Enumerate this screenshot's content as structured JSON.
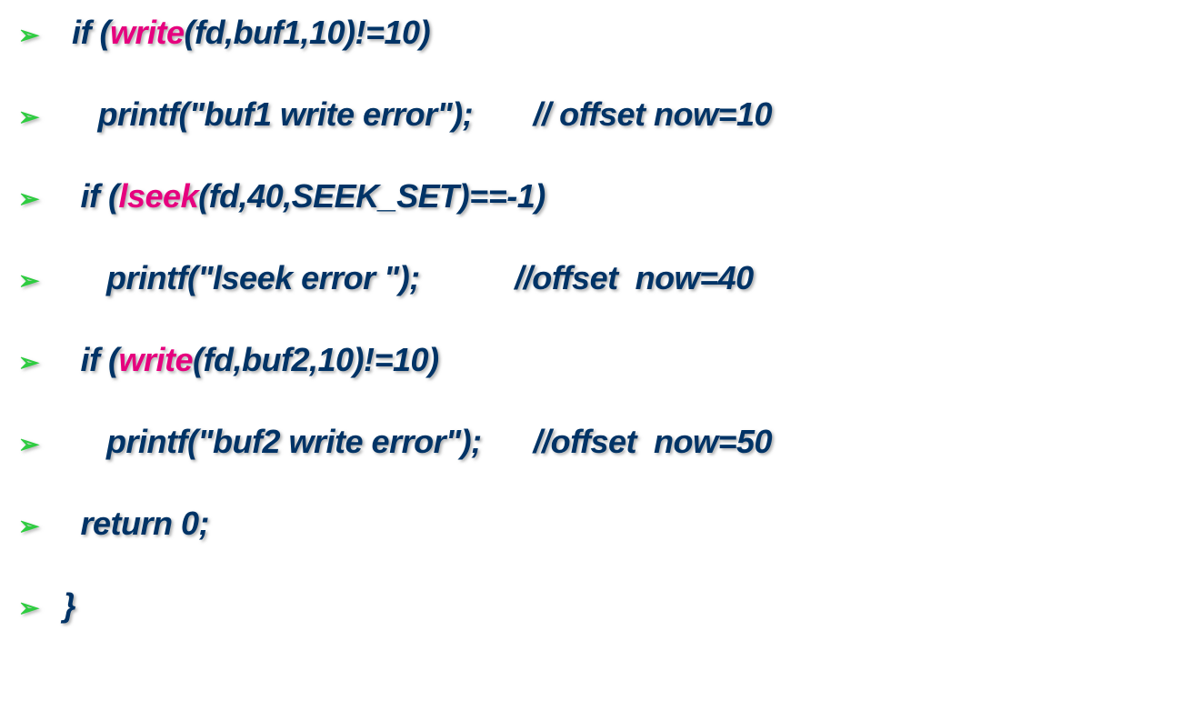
{
  "lines": [
    {
      "segments": [
        {
          "text": "  if (",
          "highlight": false
        },
        {
          "text": "write",
          "highlight": true
        },
        {
          "text": "(fd,buf1,10)!=10)",
          "highlight": false
        }
      ]
    },
    {
      "segments": [
        {
          "text": "     printf(\"buf1 write error\");       // offset now=10",
          "highlight": false
        }
      ]
    },
    {
      "segments": [
        {
          "text": "   if (",
          "highlight": false
        },
        {
          "text": "lseek",
          "highlight": true
        },
        {
          "text": "(fd,40,SEEK_SET)==-1)",
          "highlight": false
        }
      ]
    },
    {
      "segments": [
        {
          "text": "      printf(\"lseek error \");           //offset  now=40",
          "highlight": false
        }
      ]
    },
    {
      "segments": [
        {
          "text": "   if (",
          "highlight": false
        },
        {
          "text": "write",
          "highlight": true
        },
        {
          "text": "(fd,buf2,10)!=10)",
          "highlight": false
        }
      ]
    },
    {
      "segments": [
        {
          "text": "      printf(\"buf2 write error\");      //offset  now=50",
          "highlight": false
        }
      ]
    },
    {
      "segments": [
        {
          "text": "   return 0;",
          "highlight": false
        }
      ]
    },
    {
      "segments": [
        {
          "text": " }",
          "highlight": false
        }
      ]
    }
  ],
  "bullet_char": "➢"
}
